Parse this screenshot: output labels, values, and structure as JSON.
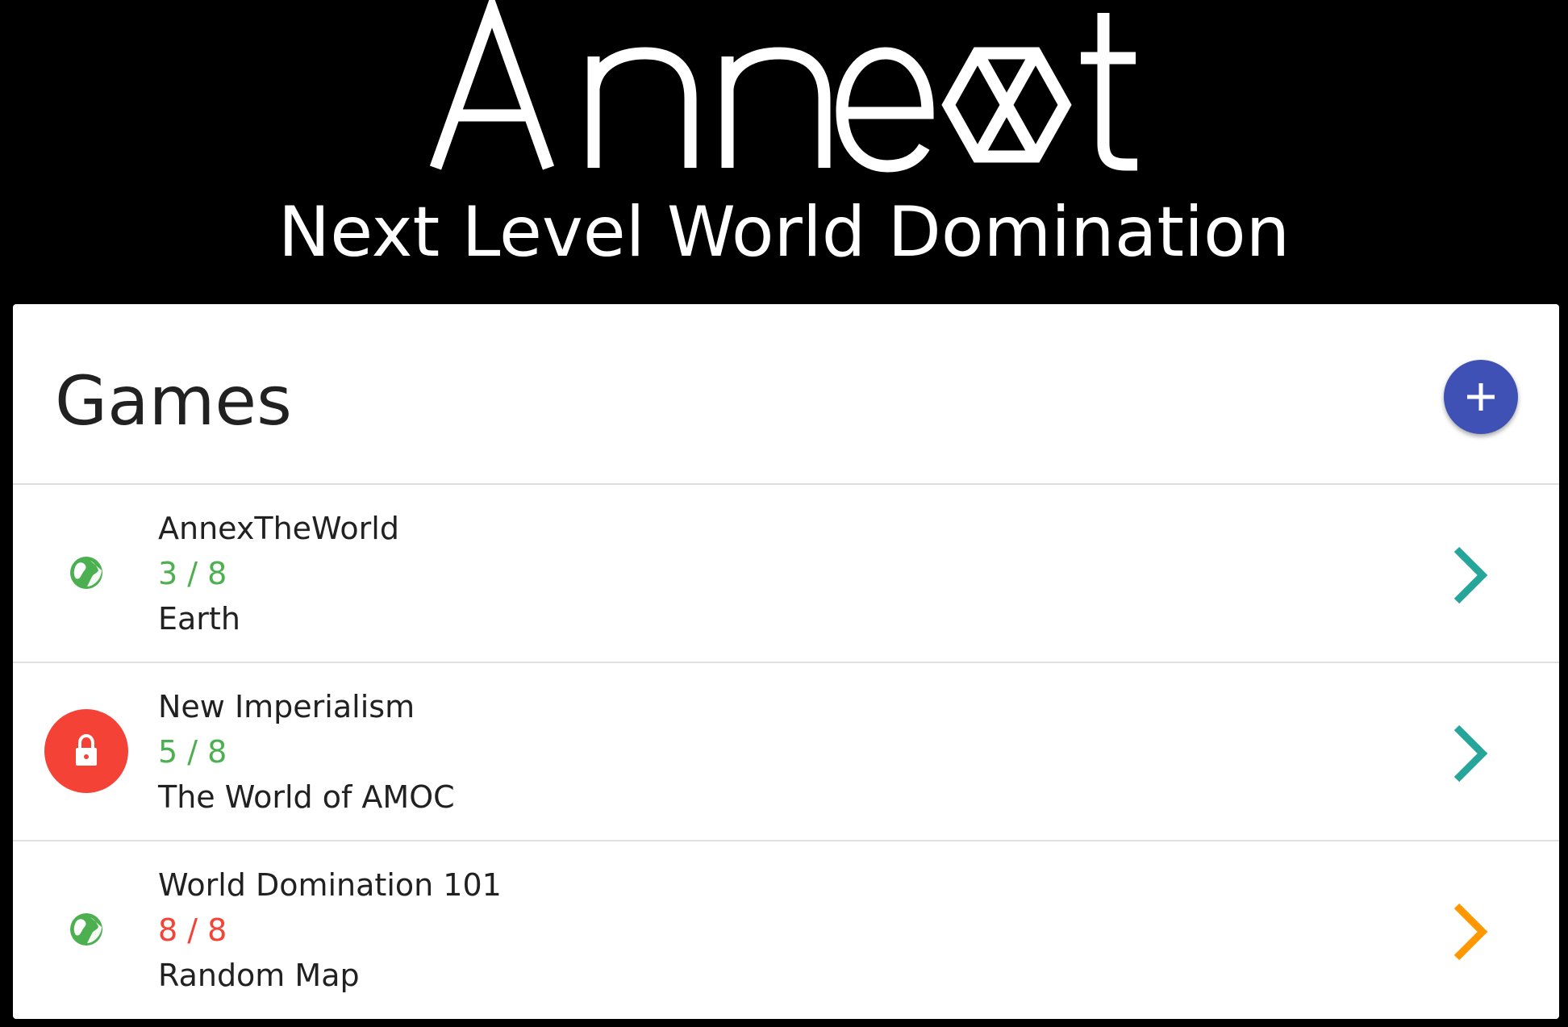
{
  "header": {
    "logo_text": "Annext",
    "tagline": "Next Level World Domination"
  },
  "games_panel": {
    "title": "Games",
    "add_button_icon": "plus-icon",
    "accent_color": "#3f51b5"
  },
  "games": [
    {
      "name": "AnnexTheWorld",
      "players": "3 / 8",
      "map": "Earth",
      "status_icon": "globe-icon",
      "players_color": "#4caf50",
      "chevron_color": "#26a69a"
    },
    {
      "name": "New Imperialism",
      "players": "5 / 8",
      "map": "The World of AMOC",
      "status_icon": "lock-icon",
      "players_color": "#4caf50",
      "chevron_color": "#26a69a"
    },
    {
      "name": "World Domination 101",
      "players": "8 / 8",
      "map": "Random Map",
      "status_icon": "globe-icon",
      "players_color": "#f44336",
      "chevron_color": "#ff9800"
    }
  ]
}
